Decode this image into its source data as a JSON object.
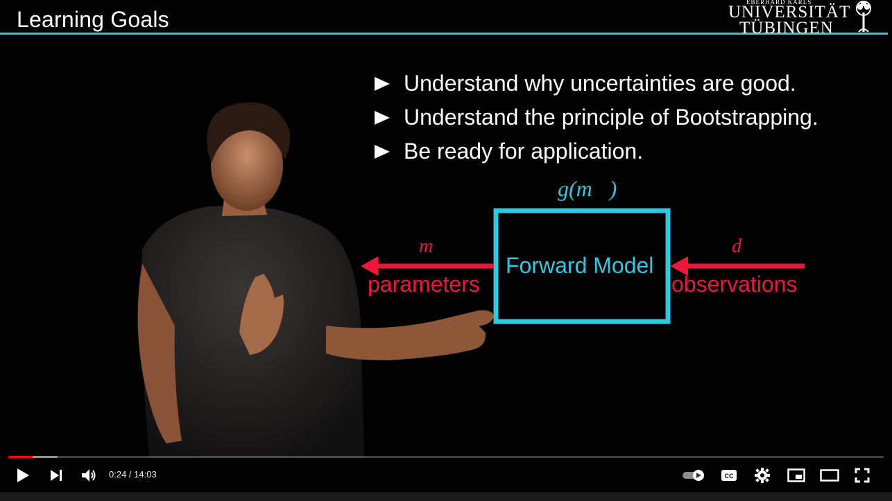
{
  "slide": {
    "title": "Learning Goals",
    "logo": {
      "top_line": "EBERHARD KARLS",
      "line1": "UNIVERSITÄT",
      "line2": "TÜBINGEN"
    },
    "bullets": [
      "Understand why uncertainties are good.",
      "Understand the principle of Bootstrapping.",
      "Be ready for application."
    ],
    "diagram": {
      "function_label": "g(m⃗)",
      "box_label": "Forward Model",
      "left_symbol": "m⃗",
      "left_label": "parameters",
      "right_symbol": "d⃗",
      "right_label": "observations"
    }
  },
  "player": {
    "current_time": "0:24",
    "separator": " / ",
    "duration": "14:03",
    "played_fraction": 0.028,
    "buffered_fraction": 0.056,
    "icons": [
      "play-icon",
      "next-icon",
      "volume-icon",
      "autoplay-toggle-icon",
      "captions-icon",
      "settings-gear-icon",
      "miniplayer-icon",
      "theater-mode-icon",
      "fullscreen-icon"
    ]
  },
  "colors": {
    "accent_cyan": "#2ec8e0",
    "arrow_red": "#f0163a",
    "progress_red": "#ff0000"
  }
}
